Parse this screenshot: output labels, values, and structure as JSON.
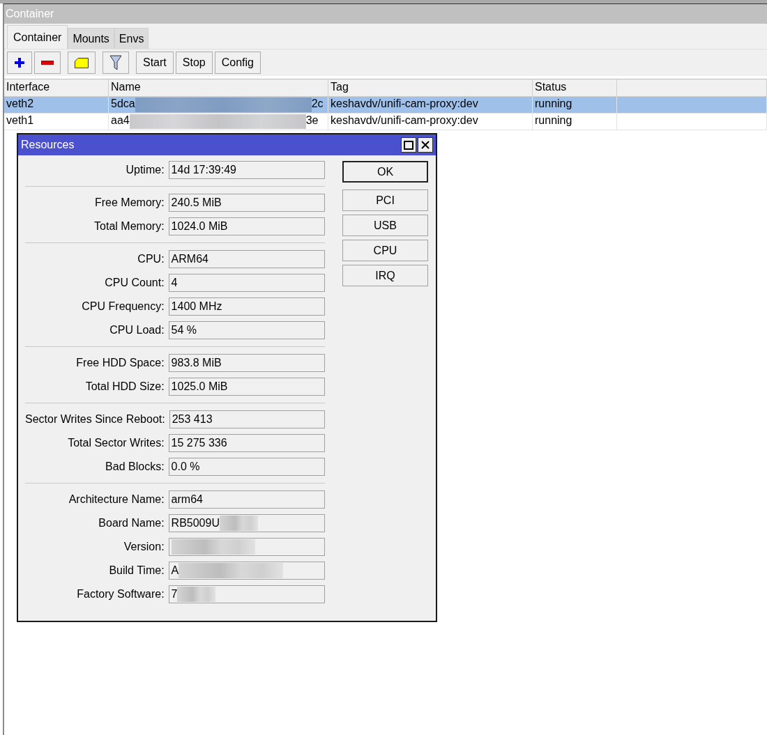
{
  "window": {
    "title": "Container"
  },
  "tabs": [
    {
      "label": "Container",
      "selected": true
    },
    {
      "label": "Mounts",
      "selected": false
    },
    {
      "label": "Envs",
      "selected": false
    }
  ],
  "toolbar": [
    {
      "kind": "add"
    },
    {
      "kind": "remove"
    },
    {
      "kind": "comment"
    },
    {
      "kind": "filter"
    },
    {
      "kind": "text",
      "label": "Start"
    },
    {
      "kind": "text",
      "label": "Stop"
    },
    {
      "kind": "text",
      "label": "Config"
    }
  ],
  "table": {
    "columns": [
      "Interface",
      "Name",
      "Tag",
      "Status"
    ],
    "rows": [
      {
        "selected": true,
        "interface": "veth2",
        "name": {
          "start": "5dca",
          "end": "2c",
          "redacted": true
        },
        "tag": "keshavdv/unifi-cam-proxy:dev",
        "status": "running"
      },
      {
        "selected": false,
        "interface": "veth1",
        "name": {
          "start": "aa4",
          "end": "3e",
          "redacted": true
        },
        "tag": "keshavdv/unifi-cam-proxy:dev",
        "status": "running"
      }
    ]
  },
  "dialog": {
    "title": "Resources",
    "groups": [
      [
        {
          "label": "Uptime:",
          "value": "14d 17:39:49"
        }
      ],
      [
        {
          "label": "Free Memory:",
          "value": "240.5 MiB"
        },
        {
          "label": "Total Memory:",
          "value": "1024.0 MiB"
        }
      ],
      [
        {
          "label": "CPU:",
          "value": "ARM64"
        },
        {
          "label": "CPU Count:",
          "value": "4"
        },
        {
          "label": "CPU Frequency:",
          "value": "1400 MHz"
        },
        {
          "label": "CPU Load:",
          "value": "54 %"
        }
      ],
      [
        {
          "label": "Free HDD Space:",
          "value": "983.8 MiB"
        },
        {
          "label": "Total HDD Size:",
          "value": "1025.0 MiB"
        }
      ],
      [
        {
          "label": "Sector Writes Since Reboot:",
          "value": "253 413"
        },
        {
          "label": "Total Sector Writes:",
          "value": "15 275 336"
        },
        {
          "label": "Bad Blocks:",
          "value": "0.0 %"
        }
      ],
      [
        {
          "label": "Architecture Name:",
          "value": "arm64"
        },
        {
          "label": "Board Name:",
          "value": "RB5009U",
          "redacted": true
        },
        {
          "label": "Version:",
          "redacted": true
        },
        {
          "label": "Build Time:",
          "value": "A",
          "redacted": true
        },
        {
          "label": "Factory Software:",
          "value": "7",
          "redacted": true
        }
      ]
    ],
    "buttons": [
      {
        "label": "OK",
        "default": true
      },
      {
        "label": "PCI",
        "default": false
      },
      {
        "label": "USB",
        "default": false
      },
      {
        "label": "CPU",
        "default": false
      },
      {
        "label": "IRQ",
        "default": false
      }
    ]
  }
}
